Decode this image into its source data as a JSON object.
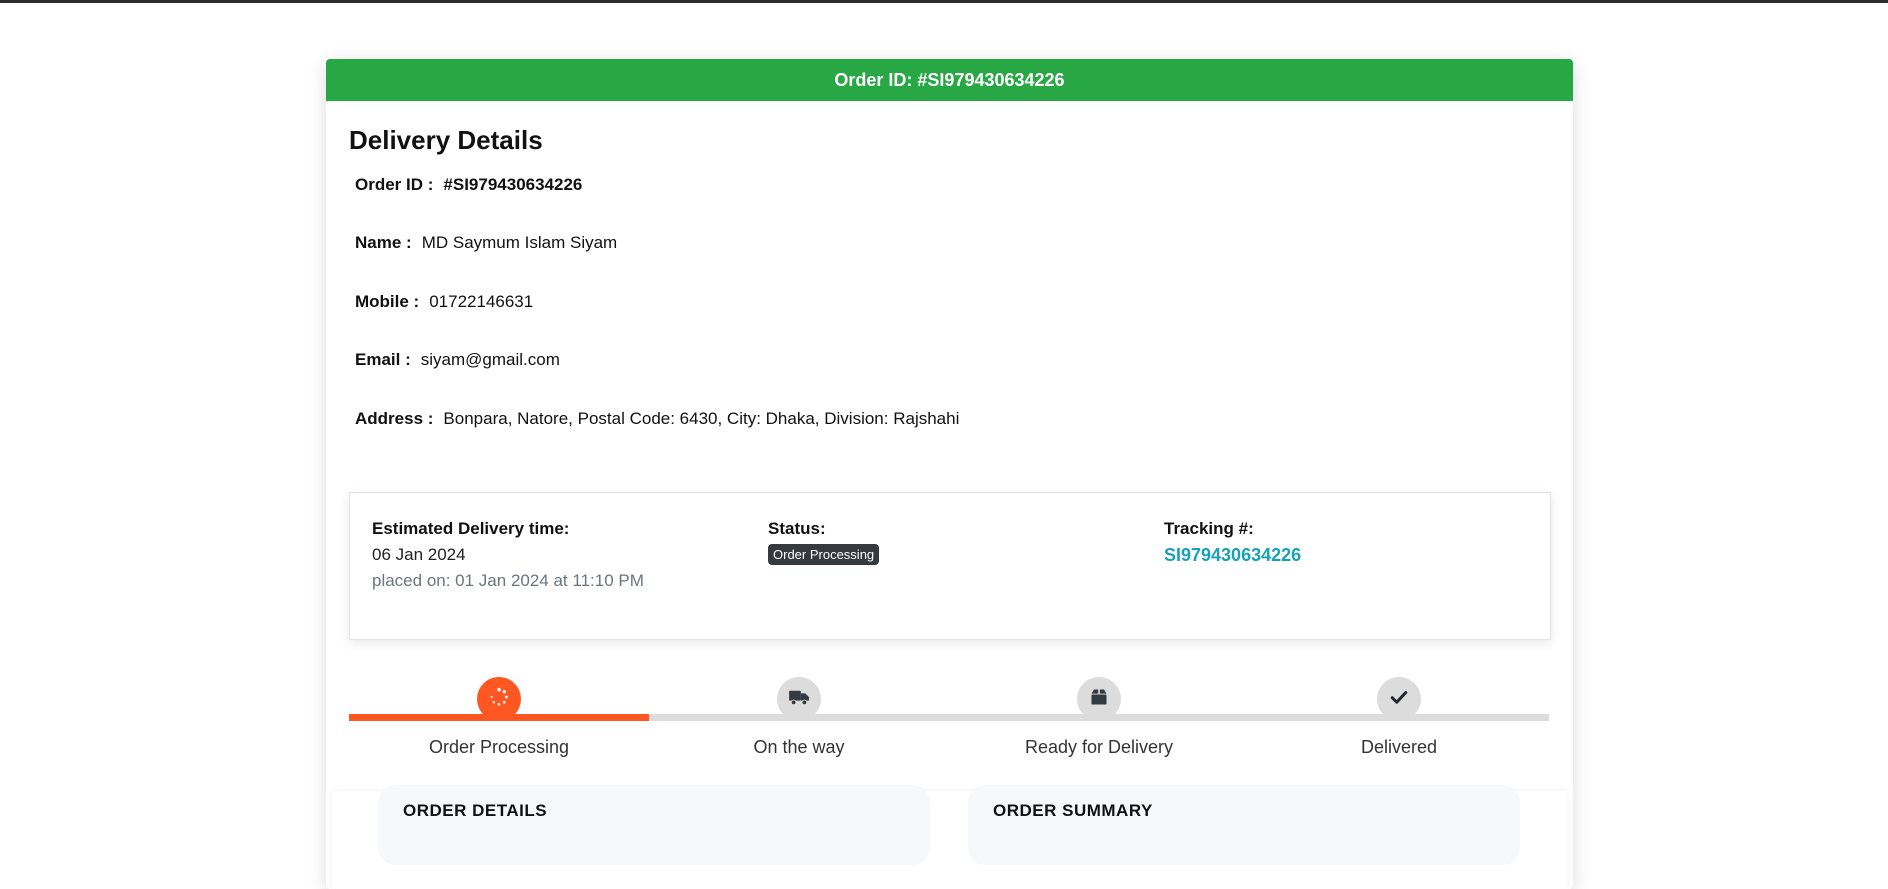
{
  "header": {
    "title": "Order ID: #SI979430634226"
  },
  "delivery": {
    "title": "Delivery Details",
    "fields": [
      {
        "label": "Order ID :",
        "value": "#SI979430634226"
      },
      {
        "label": "Name :",
        "value": "MD Saymum Islam Siyam"
      },
      {
        "label": "Mobile :",
        "value": "01722146631"
      },
      {
        "label": "Email :",
        "value": "siyam@gmail.com"
      },
      {
        "label": "Address :",
        "value": "Bonpara, Natore, Postal Code: 6430, City: Dhaka, Division: Rajshahi"
      }
    ]
  },
  "status_box": {
    "estimated": {
      "label": "Estimated Delivery time:",
      "date": "06 Jan 2024",
      "placed": "placed on: 01 Jan 2024 at 11:10 PM"
    },
    "status": {
      "label": "Status:",
      "badge": "Order Processing"
    },
    "tracking": {
      "label": "Tracking #:",
      "number": "SI979430634226"
    }
  },
  "progress": {
    "completed_fraction": 0.25,
    "accent_color": "#ff5722",
    "steps": [
      {
        "label": "Order Processing",
        "icon": "spinner-icon",
        "active": true
      },
      {
        "label": "On the way",
        "icon": "truck-icon",
        "active": false
      },
      {
        "label": "Ready for Delivery",
        "icon": "box-icon",
        "active": false
      },
      {
        "label": "Delivered",
        "icon": "check-icon",
        "active": false
      }
    ]
  },
  "panels": {
    "order_details_title": "ORDER DETAILS",
    "order_summary_title": "ORDER SUMMARY"
  },
  "colors": {
    "header_green": "#28a745",
    "badge_dark": "#343a40",
    "link_teal": "#17a2b8"
  }
}
